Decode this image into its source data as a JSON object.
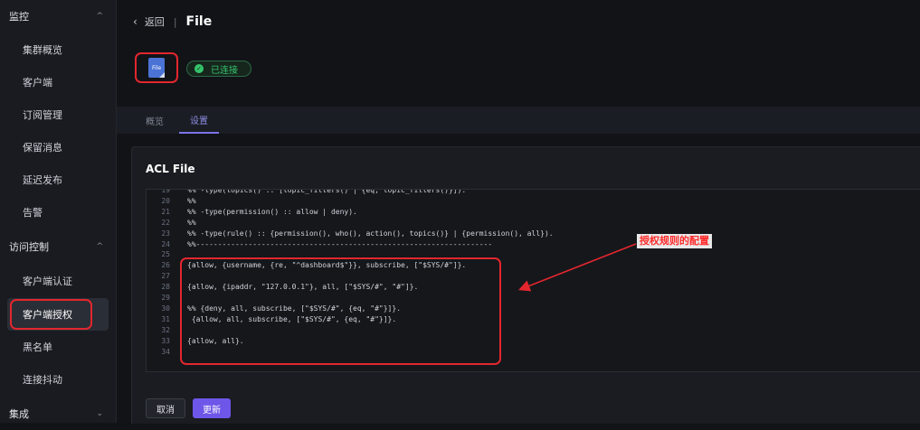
{
  "sidebar": {
    "groups": [
      {
        "label": "监控",
        "chevron": "^"
      },
      {
        "label": "访问控制",
        "chevron": "^"
      },
      {
        "label": "集成",
        "chevron": "⌄"
      }
    ],
    "monitor_items": [
      "集群概览",
      "客户端",
      "订阅管理",
      "保留消息",
      "延迟发布",
      "告警"
    ],
    "access_items": [
      "客户端认证",
      "客户端授权",
      "黑名单",
      "连接抖动"
    ],
    "active_item": "客户端授权"
  },
  "header": {
    "back_label": "返回",
    "separator": "|",
    "title": "File"
  },
  "resource": {
    "icon_label": "File",
    "status_label": "已连接",
    "status_icon": "check-circle-icon",
    "status_color": "#35c46b"
  },
  "tabs": [
    {
      "label": "概览",
      "active": false
    },
    {
      "label": "设置",
      "active": true
    }
  ],
  "card": {
    "title": "ACL File"
  },
  "code_lines": [
    {
      "n": "19",
      "text": "%% -type(topics() :: [topic_filters() | {eq, topic_filters()}])."
    },
    {
      "n": "20",
      "text": "%%"
    },
    {
      "n": "21",
      "text": "%% -type(permission() :: allow | deny)."
    },
    {
      "n": "22",
      "text": "%%"
    },
    {
      "n": "23",
      "text": "%% -type(rule() :: {permission(), who(), action(), topics()} | {permission(), all})."
    },
    {
      "n": "24",
      "text": "%%--------------------------------------------------------------------"
    },
    {
      "n": "25",
      "text": ""
    },
    {
      "n": "26",
      "text": "{allow, {username, {re, \"^dashboard$\"}}, subscribe, [\"$SYS/#\"]}."
    },
    {
      "n": "27",
      "text": ""
    },
    {
      "n": "28",
      "text": "{allow, {ipaddr, \"127.0.0.1\"}, all, [\"$SYS/#\", \"#\"]}."
    },
    {
      "n": "29",
      "text": ""
    },
    {
      "n": "30",
      "text": "%% {deny, all, subscribe, [\"$SYS/#\", {eq, \"#\"}]}."
    },
    {
      "n": "31",
      "text": " {allow, all, subscribe, [\"$SYS/#\", {eq, \"#\"}]}."
    },
    {
      "n": "32",
      "text": ""
    },
    {
      "n": "33",
      "text": "{allow, all}."
    },
    {
      "n": "34",
      "text": ""
    }
  ],
  "annotation": {
    "text": "授权规则的配置",
    "color": "#ff2a2a"
  },
  "actions": {
    "cancel_label": "取消",
    "update_label": "更新"
  },
  "colors": {
    "accent": "#6e56e8",
    "highlight_box": "#e3262e"
  }
}
